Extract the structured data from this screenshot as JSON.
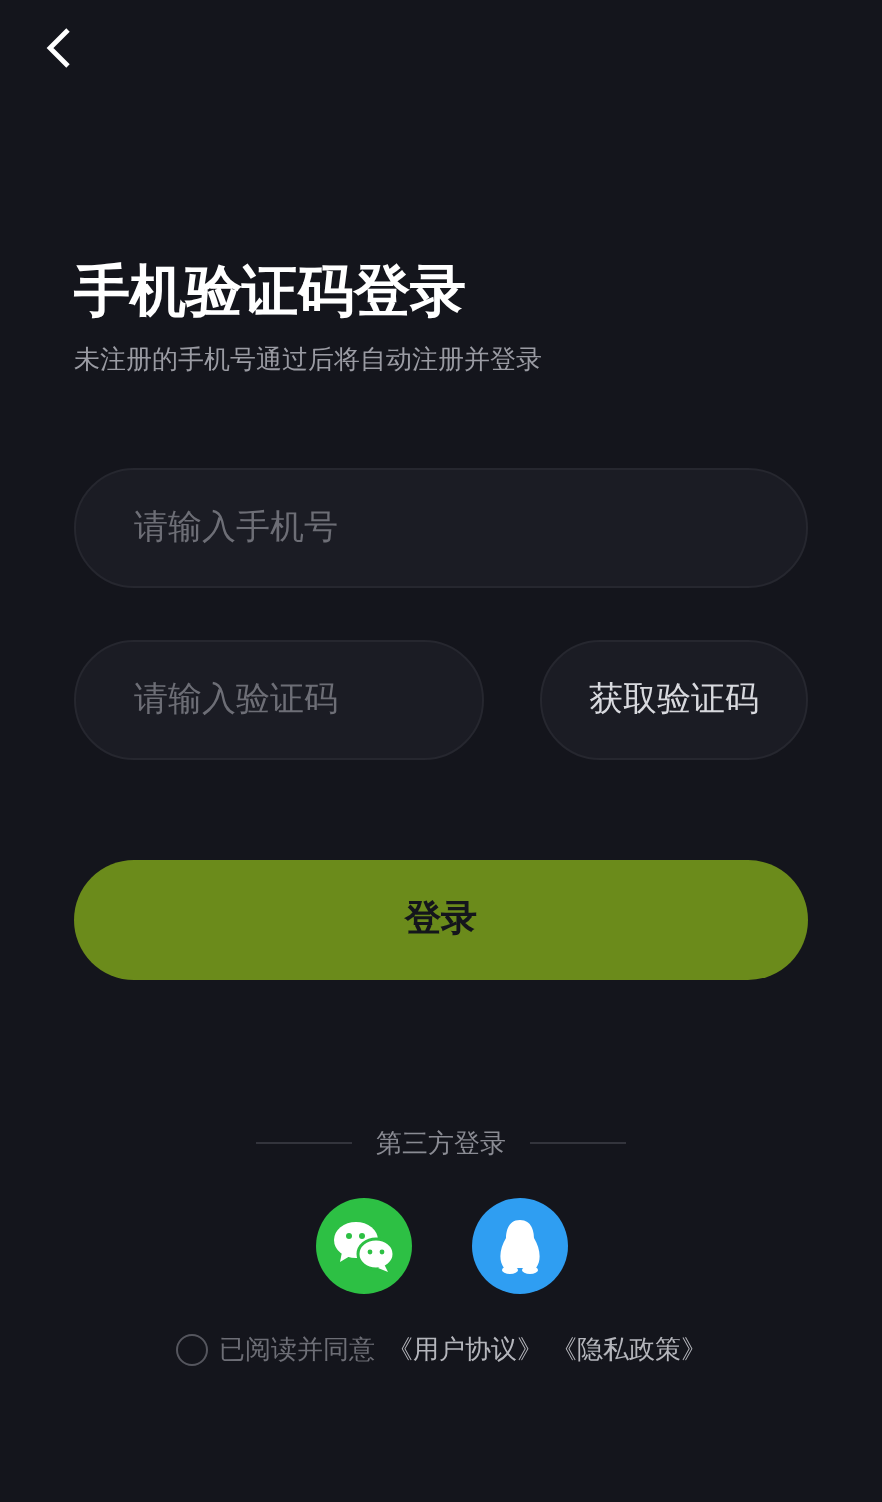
{
  "header": {
    "title": "手机验证码登录",
    "subtitle": "未注册的手机号通过后将自动注册并登录"
  },
  "phone_field": {
    "placeholder": "请输入手机号"
  },
  "code_field": {
    "placeholder": "请输入验证码"
  },
  "get_code_button": "获取验证码",
  "login_button": "登录",
  "third_party": {
    "label": "第三方登录",
    "providers": [
      {
        "kind": "chat",
        "color": "#2dc044"
      },
      {
        "kind": "penguin",
        "color": "#2f9ef2"
      }
    ]
  },
  "agreement": {
    "checked": false,
    "text": "已阅读并同意",
    "links": [
      "《用户协议》",
      "《隐私政策》"
    ]
  }
}
